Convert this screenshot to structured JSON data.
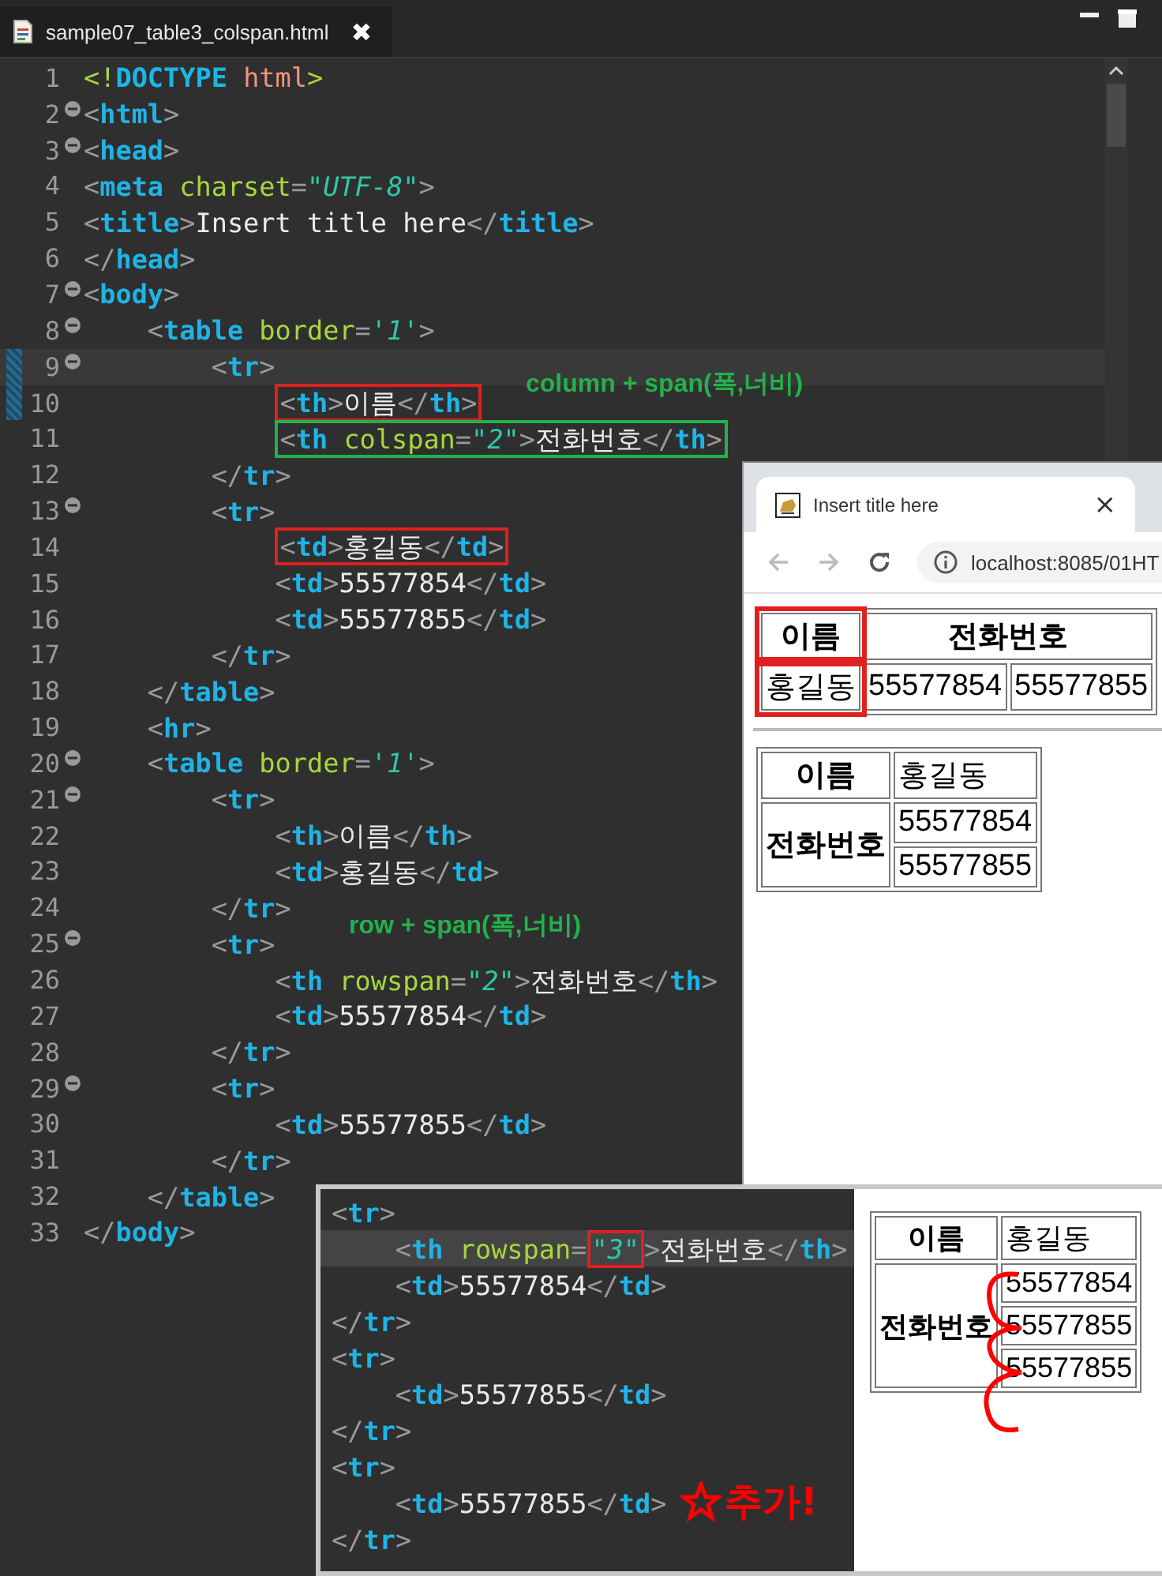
{
  "editor": {
    "tab": {
      "title": "sample07_table3_colspan.html",
      "close": "✖"
    },
    "lines": [
      {
        "n": "1",
        "fold": false,
        "current": false,
        "changed": false,
        "segments": [
          {
            "code": "<!DOCTYPE html>"
          }
        ]
      },
      {
        "n": "2",
        "fold": true,
        "current": false,
        "changed": false,
        "segments": [
          {
            "code": "<html>"
          }
        ]
      },
      {
        "n": "3",
        "fold": true,
        "current": false,
        "changed": false,
        "segments": [
          {
            "code": "<head>"
          }
        ]
      },
      {
        "n": "4",
        "fold": false,
        "current": false,
        "changed": false,
        "segments": [
          {
            "code": "<meta charset=\"UTF-8\">"
          }
        ]
      },
      {
        "n": "5",
        "fold": false,
        "current": false,
        "changed": false,
        "segments": [
          {
            "code": "<title>Insert title here</title>"
          }
        ]
      },
      {
        "n": "6",
        "fold": false,
        "current": false,
        "changed": false,
        "segments": [
          {
            "code": "</head>"
          }
        ]
      },
      {
        "n": "7",
        "fold": true,
        "current": false,
        "changed": false,
        "segments": [
          {
            "code": "<body>"
          }
        ]
      },
      {
        "n": "8",
        "fold": true,
        "current": false,
        "changed": false,
        "segments": [
          {
            "code": "    <table border='1'>"
          }
        ]
      },
      {
        "n": "9",
        "fold": true,
        "current": true,
        "changed": true,
        "segments": [
          {
            "code": "        <tr>"
          }
        ]
      },
      {
        "n": "10",
        "fold": false,
        "current": false,
        "changed": true,
        "segments": [
          {
            "code": "            <th>이름</th>",
            "color": "#e02020"
          }
        ]
      },
      {
        "n": "11",
        "fold": false,
        "current": false,
        "changed": false,
        "segments": [
          {
            "code": "            <th colspan=\"2\">전화번호</th>",
            "color": "#22b14c"
          }
        ]
      },
      {
        "n": "12",
        "fold": false,
        "current": false,
        "changed": false,
        "segments": [
          {
            "code": "        </tr>"
          }
        ]
      },
      {
        "n": "13",
        "fold": true,
        "current": false,
        "changed": false,
        "segments": [
          {
            "code": "        <tr>"
          }
        ]
      },
      {
        "n": "14",
        "fold": false,
        "current": false,
        "changed": false,
        "segments": [
          {
            "code": "            <td>홍길동</td>",
            "color": "#e02020"
          }
        ]
      },
      {
        "n": "15",
        "fold": false,
        "current": false,
        "changed": false,
        "segments": [
          {
            "code": "            <td>55577854</td>"
          }
        ]
      },
      {
        "n": "16",
        "fold": false,
        "current": false,
        "changed": false,
        "segments": [
          {
            "code": "            <td>55577855</td>"
          }
        ]
      },
      {
        "n": "17",
        "fold": false,
        "current": false,
        "changed": false,
        "segments": [
          {
            "code": "        </tr>"
          }
        ]
      },
      {
        "n": "18",
        "fold": false,
        "current": false,
        "changed": false,
        "segments": [
          {
            "code": "    </table>"
          }
        ]
      },
      {
        "n": "19",
        "fold": false,
        "current": false,
        "changed": false,
        "segments": [
          {
            "code": "    <hr>"
          }
        ]
      },
      {
        "n": "20",
        "fold": true,
        "current": false,
        "changed": false,
        "segments": [
          {
            "code": "    <table border='1'>"
          }
        ]
      },
      {
        "n": "21",
        "fold": true,
        "current": false,
        "changed": false,
        "segments": [
          {
            "code": "        <tr>"
          }
        ]
      },
      {
        "n": "22",
        "fold": false,
        "current": false,
        "changed": false,
        "segments": [
          {
            "code": "            <th>이름</th>"
          }
        ]
      },
      {
        "n": "23",
        "fold": false,
        "current": false,
        "changed": false,
        "segments": [
          {
            "code": "            <td>홍길동</td>"
          }
        ]
      },
      {
        "n": "24",
        "fold": false,
        "current": false,
        "changed": false,
        "segments": [
          {
            "code": "        </tr>"
          }
        ]
      },
      {
        "n": "25",
        "fold": true,
        "current": false,
        "changed": false,
        "segments": [
          {
            "code": "        <tr>"
          }
        ]
      },
      {
        "n": "26",
        "fold": false,
        "current": false,
        "changed": false,
        "segments": [
          {
            "code": "            <th rowspan=\"2\">전화번호</th>"
          }
        ]
      },
      {
        "n": "27",
        "fold": false,
        "current": false,
        "changed": false,
        "segments": [
          {
            "code": "            <td>55577854</td>"
          }
        ]
      },
      {
        "n": "28",
        "fold": false,
        "current": false,
        "changed": false,
        "segments": [
          {
            "code": "        </tr>"
          }
        ]
      },
      {
        "n": "29",
        "fold": true,
        "current": false,
        "changed": false,
        "segments": [
          {
            "code": "        <tr>"
          }
        ]
      },
      {
        "n": "30",
        "fold": false,
        "current": false,
        "changed": false,
        "segments": [
          {
            "code": "            <td>55577855</td>"
          }
        ]
      },
      {
        "n": "31",
        "fold": false,
        "current": false,
        "changed": false,
        "segments": [
          {
            "code": "        </tr>"
          }
        ]
      },
      {
        "n": "32",
        "fold": false,
        "current": false,
        "changed": false,
        "segments": [
          {
            "code": "    </table>"
          }
        ]
      },
      {
        "n": "33",
        "fold": false,
        "current": false,
        "changed": false,
        "segments": [
          {
            "code": "</body>"
          }
        ]
      }
    ],
    "notes": [
      "column + span(폭,너비)",
      "row + span(폭,너비)"
    ]
  },
  "browser": {
    "tab_title": "Insert title here",
    "tab_close": "×",
    "address": "localhost:8085/01HT",
    "tables": [
      {
        "rows": [
          [
            {
              "text": "이름",
              "header": true,
              "marked": true
            },
            {
              "text": "전화번호",
              "header": true,
              "marked": false,
              "colspan": 2
            }
          ],
          [
            {
              "text": "홍길동",
              "header": false,
              "marked": true
            },
            {
              "text": "55577854",
              "header": false,
              "marked": false
            },
            {
              "text": "55577855",
              "header": false,
              "marked": false
            }
          ]
        ]
      },
      {
        "rows": [
          [
            {
              "text": "이름",
              "header": true,
              "marked": false
            },
            {
              "text": "홍길동",
              "header": false,
              "marked": false
            }
          ],
          [
            {
              "text": "전화번호",
              "header": true,
              "marked": false,
              "rowspan": 2
            },
            {
              "text": "55577854",
              "header": false,
              "marked": false
            }
          ],
          [
            {
              "text": "55577855",
              "header": false,
              "marked": false
            }
          ]
        ]
      }
    ]
  },
  "inset": {
    "lines": [
      {
        "current": false,
        "segments": [
          {
            "code": "<tr>"
          }
        ]
      },
      {
        "current": true,
        "segments": [
          {
            "code": "    <th rowspan="
          },
          {
            "code": "\"3\"",
            "color": "#e02020"
          },
          {
            "code": ">전화번호</th>"
          }
        ]
      },
      {
        "current": false,
        "segments": [
          {
            "code": "    <td>55577854</td>"
          }
        ]
      },
      {
        "current": false,
        "segments": [
          {
            "code": "</tr>"
          }
        ]
      },
      {
        "current": false,
        "segments": [
          {
            "code": "<tr>"
          }
        ]
      },
      {
        "current": false,
        "segments": [
          {
            "code": "    <td>55577855</td>"
          }
        ]
      },
      {
        "current": false,
        "segments": [
          {
            "code": "</tr>"
          }
        ]
      },
      {
        "current": false,
        "segments": [
          {
            "code": "<tr>"
          }
        ]
      },
      {
        "current": false,
        "segments": [
          {
            "code": "    <td>55577855</td>"
          }
        ]
      },
      {
        "current": false,
        "segments": [
          {
            "code": "</tr>"
          }
        ]
      }
    ],
    "note": "추가!",
    "table": {
      "rows": [
        [
          {
            "text": "이름",
            "header": true
          },
          {
            "text": "홍길동",
            "header": false
          }
        ],
        [
          {
            "text": "전화번호",
            "header": true,
            "rowspan": 3
          },
          {
            "text": "55577854",
            "header": false
          }
        ],
        [
          {
            "text": "55577855",
            "header": false
          }
        ],
        [
          {
            "text": "55577855",
            "header": false
          }
        ]
      ]
    }
  }
}
